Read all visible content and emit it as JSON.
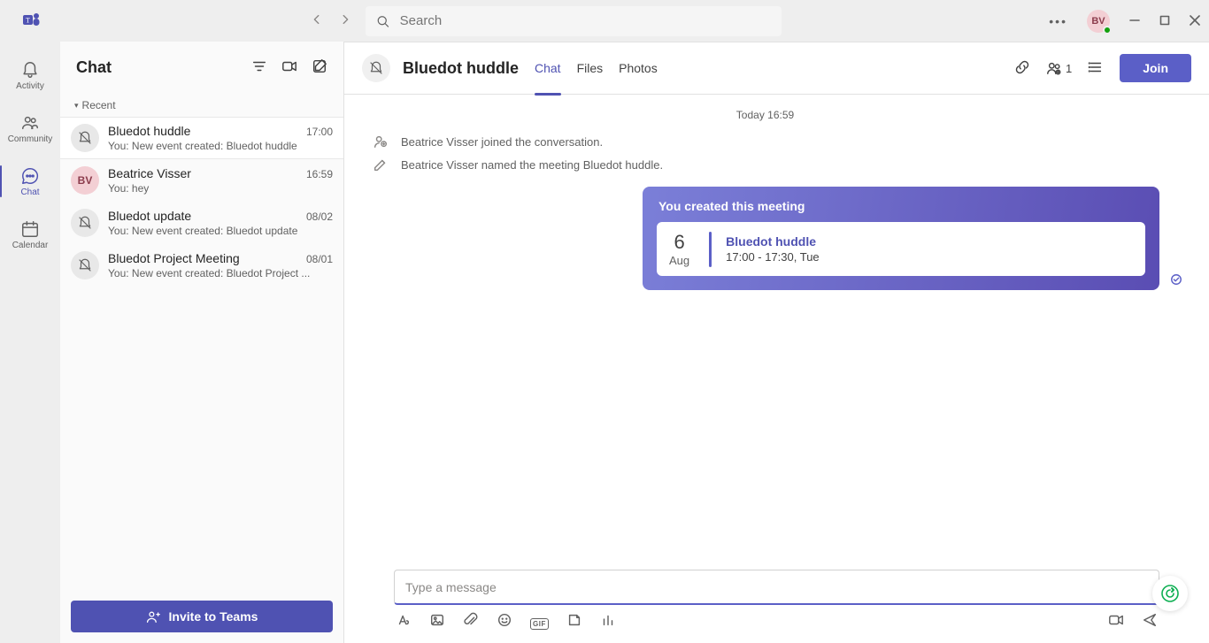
{
  "titlebar": {
    "search_placeholder": "Search",
    "avatar_initials": "BV"
  },
  "rail": {
    "activity": "Activity",
    "community": "Community",
    "chat": "Chat",
    "calendar": "Calendar"
  },
  "panel": {
    "title": "Chat",
    "section": "Recent",
    "invite": "Invite to Teams",
    "items": [
      {
        "title": "Bluedot huddle",
        "time": "17:00",
        "preview": "You: New event created: Bluedot huddle",
        "avatar_type": "bell",
        "initials": ""
      },
      {
        "title": "Beatrice Visser",
        "time": "16:59",
        "preview": "You: hey",
        "avatar_type": "initials",
        "initials": "BV"
      },
      {
        "title": "Bluedot update",
        "time": "08/02",
        "preview": "You: New event created: Bluedot update",
        "avatar_type": "bell",
        "initials": ""
      },
      {
        "title": "Bluedot Project Meeting",
        "time": "08/01",
        "preview": "You: New event created: Bluedot Project ...",
        "avatar_type": "bell",
        "initials": ""
      }
    ]
  },
  "chat": {
    "title": "Bluedot huddle",
    "tabs": {
      "chat": "Chat",
      "files": "Files",
      "photos": "Photos"
    },
    "participants_count": "1",
    "join": "Join",
    "day_label": "Today 16:59",
    "sys_joined": "Beatrice Visser joined the conversation.",
    "sys_named": "Beatrice Visser named the meeting Bluedot huddle.",
    "card": {
      "created": "You created this meeting",
      "day": "6",
      "month": "Aug",
      "title": "Bluedot huddle",
      "time": "17:00 - 17:30, Tue"
    },
    "compose_placeholder": "Type a message"
  }
}
